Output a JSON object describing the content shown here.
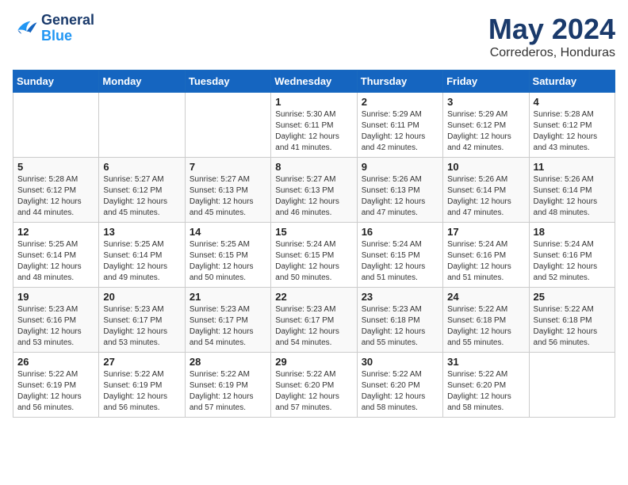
{
  "header": {
    "logo_line1": "General",
    "logo_line2": "Blue",
    "main_title": "May 2024",
    "subtitle": "Correderos, Honduras"
  },
  "days_of_week": [
    "Sunday",
    "Monday",
    "Tuesday",
    "Wednesday",
    "Thursday",
    "Friday",
    "Saturday"
  ],
  "weeks": [
    [
      {
        "day": "",
        "info": ""
      },
      {
        "day": "",
        "info": ""
      },
      {
        "day": "",
        "info": ""
      },
      {
        "day": "1",
        "info": "Sunrise: 5:30 AM\nSunset: 6:11 PM\nDaylight: 12 hours\nand 41 minutes."
      },
      {
        "day": "2",
        "info": "Sunrise: 5:29 AM\nSunset: 6:11 PM\nDaylight: 12 hours\nand 42 minutes."
      },
      {
        "day": "3",
        "info": "Sunrise: 5:29 AM\nSunset: 6:12 PM\nDaylight: 12 hours\nand 42 minutes."
      },
      {
        "day": "4",
        "info": "Sunrise: 5:28 AM\nSunset: 6:12 PM\nDaylight: 12 hours\nand 43 minutes."
      }
    ],
    [
      {
        "day": "5",
        "info": "Sunrise: 5:28 AM\nSunset: 6:12 PM\nDaylight: 12 hours\nand 44 minutes."
      },
      {
        "day": "6",
        "info": "Sunrise: 5:27 AM\nSunset: 6:12 PM\nDaylight: 12 hours\nand 45 minutes."
      },
      {
        "day": "7",
        "info": "Sunrise: 5:27 AM\nSunset: 6:13 PM\nDaylight: 12 hours\nand 45 minutes."
      },
      {
        "day": "8",
        "info": "Sunrise: 5:27 AM\nSunset: 6:13 PM\nDaylight: 12 hours\nand 46 minutes."
      },
      {
        "day": "9",
        "info": "Sunrise: 5:26 AM\nSunset: 6:13 PM\nDaylight: 12 hours\nand 47 minutes."
      },
      {
        "day": "10",
        "info": "Sunrise: 5:26 AM\nSunset: 6:14 PM\nDaylight: 12 hours\nand 47 minutes."
      },
      {
        "day": "11",
        "info": "Sunrise: 5:26 AM\nSunset: 6:14 PM\nDaylight: 12 hours\nand 48 minutes."
      }
    ],
    [
      {
        "day": "12",
        "info": "Sunrise: 5:25 AM\nSunset: 6:14 PM\nDaylight: 12 hours\nand 48 minutes."
      },
      {
        "day": "13",
        "info": "Sunrise: 5:25 AM\nSunset: 6:14 PM\nDaylight: 12 hours\nand 49 minutes."
      },
      {
        "day": "14",
        "info": "Sunrise: 5:25 AM\nSunset: 6:15 PM\nDaylight: 12 hours\nand 50 minutes."
      },
      {
        "day": "15",
        "info": "Sunrise: 5:24 AM\nSunset: 6:15 PM\nDaylight: 12 hours\nand 50 minutes."
      },
      {
        "day": "16",
        "info": "Sunrise: 5:24 AM\nSunset: 6:15 PM\nDaylight: 12 hours\nand 51 minutes."
      },
      {
        "day": "17",
        "info": "Sunrise: 5:24 AM\nSunset: 6:16 PM\nDaylight: 12 hours\nand 51 minutes."
      },
      {
        "day": "18",
        "info": "Sunrise: 5:24 AM\nSunset: 6:16 PM\nDaylight: 12 hours\nand 52 minutes."
      }
    ],
    [
      {
        "day": "19",
        "info": "Sunrise: 5:23 AM\nSunset: 6:16 PM\nDaylight: 12 hours\nand 53 minutes."
      },
      {
        "day": "20",
        "info": "Sunrise: 5:23 AM\nSunset: 6:17 PM\nDaylight: 12 hours\nand 53 minutes."
      },
      {
        "day": "21",
        "info": "Sunrise: 5:23 AM\nSunset: 6:17 PM\nDaylight: 12 hours\nand 54 minutes."
      },
      {
        "day": "22",
        "info": "Sunrise: 5:23 AM\nSunset: 6:17 PM\nDaylight: 12 hours\nand 54 minutes."
      },
      {
        "day": "23",
        "info": "Sunrise: 5:23 AM\nSunset: 6:18 PM\nDaylight: 12 hours\nand 55 minutes."
      },
      {
        "day": "24",
        "info": "Sunrise: 5:22 AM\nSunset: 6:18 PM\nDaylight: 12 hours\nand 55 minutes."
      },
      {
        "day": "25",
        "info": "Sunrise: 5:22 AM\nSunset: 6:18 PM\nDaylight: 12 hours\nand 56 minutes."
      }
    ],
    [
      {
        "day": "26",
        "info": "Sunrise: 5:22 AM\nSunset: 6:19 PM\nDaylight: 12 hours\nand 56 minutes."
      },
      {
        "day": "27",
        "info": "Sunrise: 5:22 AM\nSunset: 6:19 PM\nDaylight: 12 hours\nand 56 minutes."
      },
      {
        "day": "28",
        "info": "Sunrise: 5:22 AM\nSunset: 6:19 PM\nDaylight: 12 hours\nand 57 minutes."
      },
      {
        "day": "29",
        "info": "Sunrise: 5:22 AM\nSunset: 6:20 PM\nDaylight: 12 hours\nand 57 minutes."
      },
      {
        "day": "30",
        "info": "Sunrise: 5:22 AM\nSunset: 6:20 PM\nDaylight: 12 hours\nand 58 minutes."
      },
      {
        "day": "31",
        "info": "Sunrise: 5:22 AM\nSunset: 6:20 PM\nDaylight: 12 hours\nand 58 minutes."
      },
      {
        "day": "",
        "info": ""
      }
    ]
  ]
}
